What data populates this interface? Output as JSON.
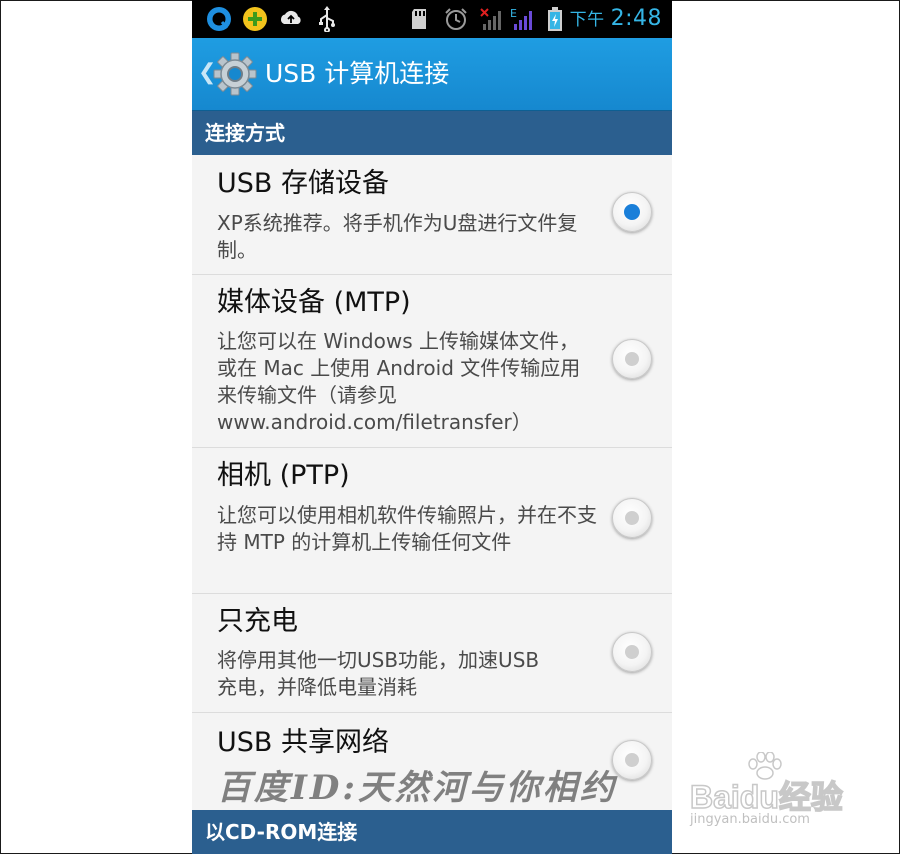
{
  "status_bar": {
    "ampm": "下午",
    "time": "2:48",
    "icons": [
      "qq-icon",
      "plus-app-icon",
      "cloud-upload-icon",
      "usb-icon",
      "sd-card-icon",
      "alarm-icon",
      "signal-no-sim-icon",
      "signal-edge-icon",
      "battery-charging-icon"
    ]
  },
  "action_bar": {
    "back_glyph": "❮",
    "icon": "settings-gear-icon",
    "title": "USB 计算机连接"
  },
  "sections": [
    {
      "label": "连接方式"
    },
    {
      "label": "以CD-ROM连接"
    }
  ],
  "options": [
    {
      "title": "USB 存储设备",
      "description": "XP系统推荐。将手机作为U盘进行文件复制。",
      "checked": true
    },
    {
      "title": "媒体设备 (MTP)",
      "description": "让您可以在 Windows 上传输媒体文件，或在 Mac 上使用 Android 文件传输应用来传输文件（请参见 www.android.com/filetransfer）",
      "checked": false
    },
    {
      "title": "相机 (PTP)",
      "description": "让您可以使用相机软件传输照片，并在不支持 MTP 的计算机上传输任何文件",
      "checked": false
    },
    {
      "title": "只充电",
      "description": "将停用其他一切USB功能，加速USB充电，并降低电量消耗",
      "checked": false
    },
    {
      "title": "USB 共享网络",
      "description": "",
      "checked": false
    }
  ],
  "watermarks": {
    "handwritten": "百度ID:天然河与你相约",
    "logo_text": "Baidu经验",
    "logo_url": "jingyan.baidu.com"
  },
  "colors": {
    "accent": "#1a7fd9",
    "action_bar": "#1688cf",
    "section_header": "#2b5f8f",
    "status_text": "#35b5e5"
  }
}
